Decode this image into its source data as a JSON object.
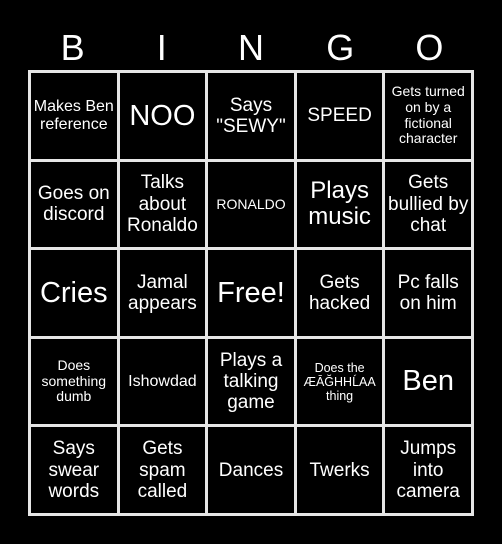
{
  "header": {
    "letters": [
      "B",
      "I",
      "N",
      "G",
      "O"
    ]
  },
  "colors": {
    "background": "#000000",
    "grid_lines": "#e6e6e6",
    "text": "#ffffff"
  },
  "board": {
    "rows": [
      [
        "Makes Ben reference",
        "NOO",
        "Says \"SEWY\"",
        "SPEED",
        "Gets turned on by a fictional character"
      ],
      [
        "Goes on discord",
        "Talks about Ronaldo",
        "RONALDO",
        "Plays music",
        "Gets bullied by chat"
      ],
      [
        "Cries",
        "Jamal appears",
        "Free!",
        "Gets hacked",
        "Pc falls on him"
      ],
      [
        "Does something dumb",
        "Ishowdad",
        "Plays a talking game",
        "Does the ÆĀĞHHĹAA thing",
        "Ben"
      ],
      [
        "Says swear words",
        "Gets spam called",
        "Dances",
        "Twerks",
        "Jumps into camera"
      ]
    ]
  }
}
